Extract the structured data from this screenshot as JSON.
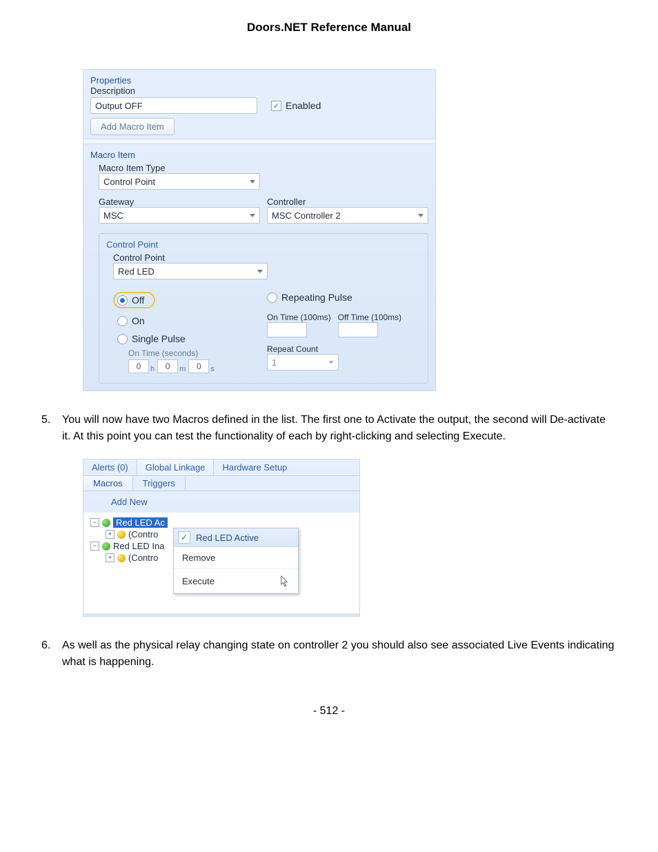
{
  "doc_title": "Doors.NET Reference Manual",
  "page_number": "- 512 -",
  "panel1": {
    "properties_header": "Properties",
    "description_label": "Description",
    "description_value": "Output OFF",
    "enabled_label": "Enabled",
    "add_macro_btn": "Add Macro Item",
    "macro_item_header": "Macro Item",
    "macro_item_type_label": "Macro Item Type",
    "macro_item_type_value": "Control Point",
    "gateway_label": "Gateway",
    "gateway_value": "MSC",
    "controller_label": "Controller",
    "controller_value": "MSC Controller 2",
    "cp_group_title": "Control Point",
    "cp_label": "Control Point",
    "cp_value": "Red LED",
    "radio_off": "Off",
    "radio_on": "On",
    "radio_single": "Single Pulse",
    "radio_repeating": "Repeating Pulse",
    "on_time_seconds_label": "On Time (seconds)",
    "on_time_100_label": "On Time (100ms)",
    "off_time_100_label": "Off Time (100ms)",
    "repeat_count_label": "Repeat Count",
    "repeat_count_value": "1",
    "h": "0",
    "m": "0",
    "s": "0",
    "h_u": "h",
    "m_u": "m",
    "s_u": "s"
  },
  "step5": {
    "num": "5.",
    "text": "You will now have two Macros defined in the list. The first one to Activate the output, the second will De-activate it. At this point you can test the functionality of each by right-clicking and selecting Execute."
  },
  "panel2": {
    "tab_alerts": "Alerts (0)",
    "tab_global": "Global Linkage",
    "tab_hardware": "Hardware Setup",
    "subtab_macros": "Macros",
    "subtab_triggers": "Triggers",
    "add_new": "Add New",
    "tree": {
      "item1": "Red LED Ac",
      "item1_child": "(Contro",
      "item2": "Red LED Ina",
      "item2_child": "(Contro"
    },
    "ctx_header": "Red LED Active",
    "ctx_remove": "Remove",
    "ctx_execute": "Execute"
  },
  "step6": {
    "num": "6.",
    "text": "As well as the physical relay changing state on controller 2 you should also see associated Live Events indicating what is happening."
  }
}
